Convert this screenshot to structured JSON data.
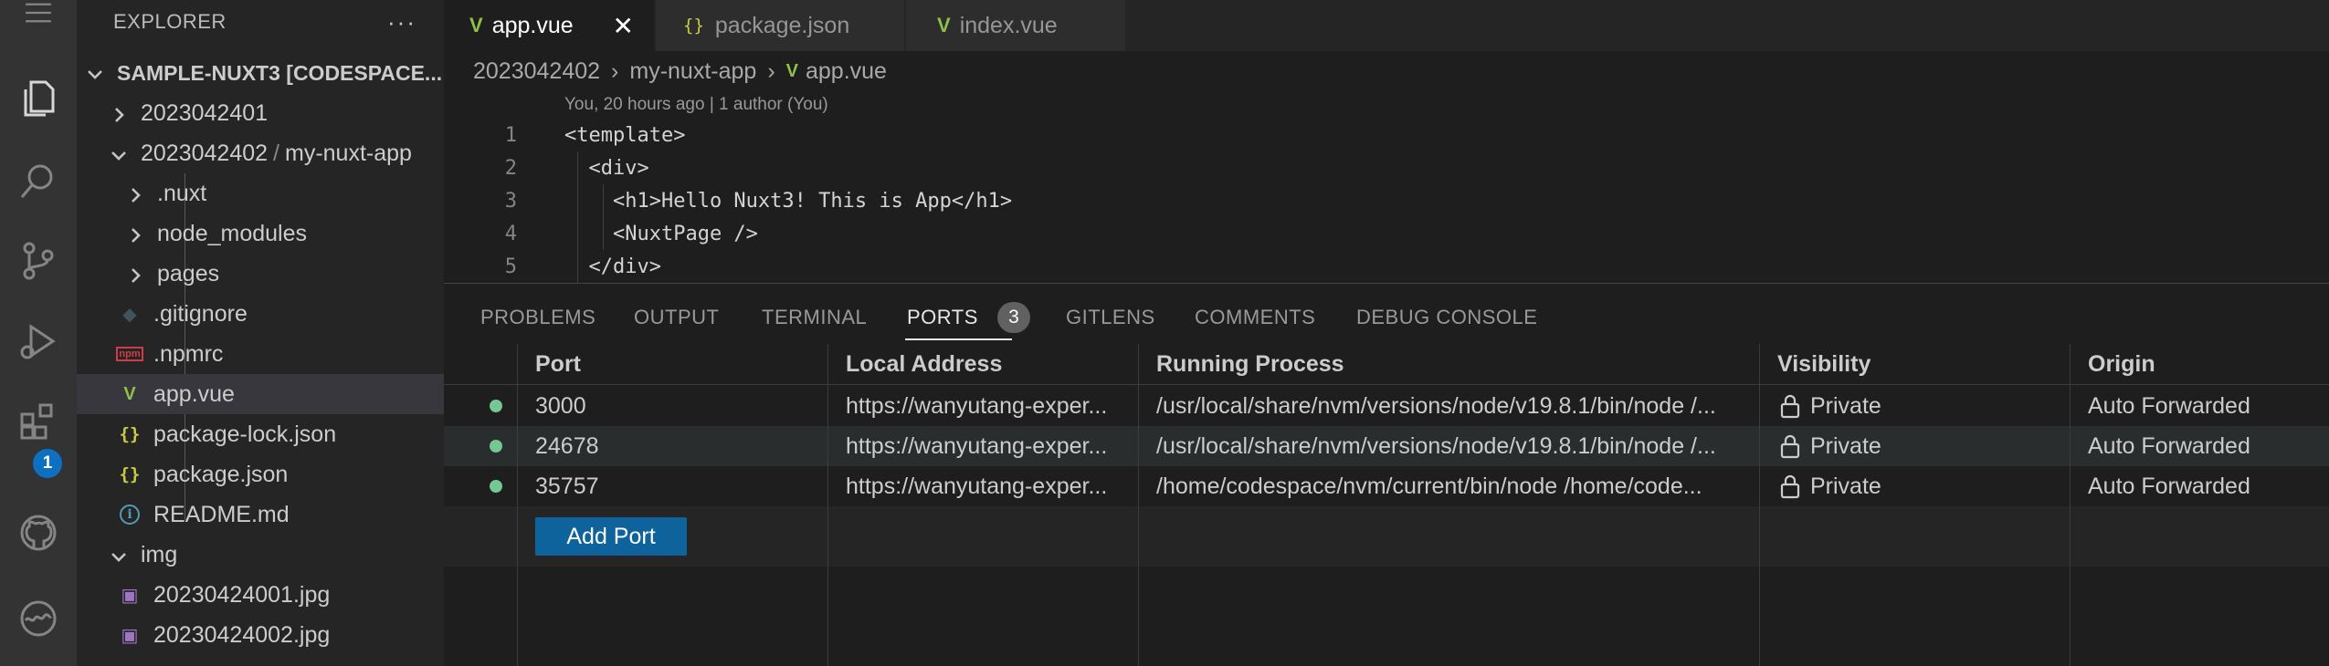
{
  "activity": {
    "extensions_badge": "1"
  },
  "explorer": {
    "title": "EXPLORER",
    "more": "···",
    "root": "SAMPLE-NUXT3 [CODESPACE...",
    "items": [
      {
        "label": "2023042401"
      },
      {
        "label": "2023042402",
        "sub": "my-nuxt-app"
      },
      {
        "label": ".nuxt"
      },
      {
        "label": "node_modules"
      },
      {
        "label": "pages"
      },
      {
        "label": ".gitignore"
      },
      {
        "label": ".npmrc"
      },
      {
        "label": "app.vue"
      },
      {
        "label": "package-lock.json"
      },
      {
        "label": "package.json"
      },
      {
        "label": "README.md"
      },
      {
        "label": "img"
      },
      {
        "label": "20230424001.jpg"
      },
      {
        "label": "20230424002.jpg"
      }
    ]
  },
  "tabs": [
    {
      "label": "app.vue",
      "close": "✕"
    },
    {
      "label": "package.json"
    },
    {
      "label": "index.vue"
    }
  ],
  "breadcrumb": {
    "a": "2023042402",
    "b": "my-nuxt-app",
    "c": "app.vue"
  },
  "codelens": "You, 20 hours ago | 1 author (You)",
  "code": [
    {
      "n": "1",
      "text": "<template>"
    },
    {
      "n": "2",
      "text": "  <div>"
    },
    {
      "n": "3",
      "text": "    <h1>Hello Nuxt3! This is App</h1>"
    },
    {
      "n": "4",
      "text": "    <NuxtPage />"
    },
    {
      "n": "5",
      "text": "  </div>"
    }
  ],
  "panel": {
    "tabs": [
      "PROBLEMS",
      "OUTPUT",
      "TERMINAL",
      "PORTS",
      "GITLENS",
      "COMMENTS",
      "DEBUG CONSOLE"
    ],
    "ports_count": "3",
    "headers": {
      "port": "Port",
      "local": "Local Address",
      "process": "Running Process",
      "visibility": "Visibility",
      "origin": "Origin"
    },
    "rows": [
      {
        "port": "3000",
        "local": "https://wanyutang-exper...",
        "process": "/usr/local/share/nvm/versions/node/v19.8.1/bin/node /...",
        "visibility": "Private",
        "origin": "Auto Forwarded"
      },
      {
        "port": "24678",
        "local": "https://wanyutang-exper...",
        "process": "/usr/local/share/nvm/versions/node/v19.8.1/bin/node /...",
        "visibility": "Private",
        "origin": "Auto Forwarded"
      },
      {
        "port": "35757",
        "local": "https://wanyutang-exper...",
        "process": "/home/codespace/nvm/current/bin/node /home/code...",
        "visibility": "Private",
        "origin": "Auto Forwarded"
      }
    ],
    "add_port": "Add Port"
  },
  "colors": {
    "accent": "#0e639c",
    "badge": "#0e70c0",
    "vue": "#8dc149",
    "json": "#cbcb41",
    "running": "#73c991"
  }
}
